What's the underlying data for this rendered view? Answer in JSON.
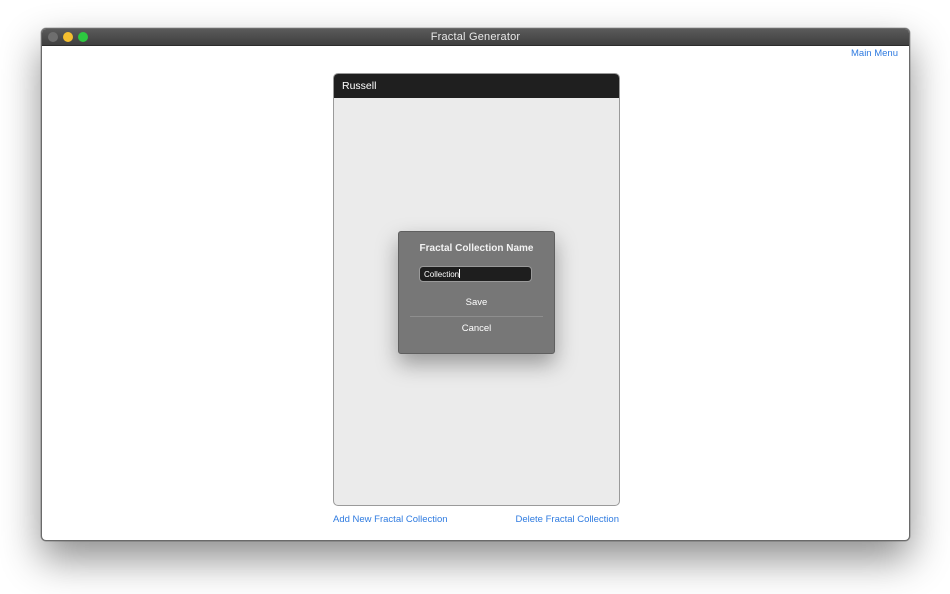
{
  "window": {
    "title": "Fractal Generator",
    "controls": [
      "close",
      "minimize",
      "zoom"
    ]
  },
  "toolbar": {
    "main_menu": "Main Menu"
  },
  "panel": {
    "title": "Russell"
  },
  "dialog": {
    "title": "Fractal Collection Name",
    "name_value": "Collection",
    "save_label": "Save",
    "cancel_label": "Cancel"
  },
  "footer": {
    "add_label": "Add New Fractal Collection",
    "delete_label": "Delete Fractal Collection"
  },
  "colors": {
    "accent_link": "#2f7be0",
    "panel_header": "#1f1f1f",
    "dialog_bg": "#777777",
    "traffic_yellow": "#f5bf2f",
    "traffic_green": "#2dc840"
  }
}
